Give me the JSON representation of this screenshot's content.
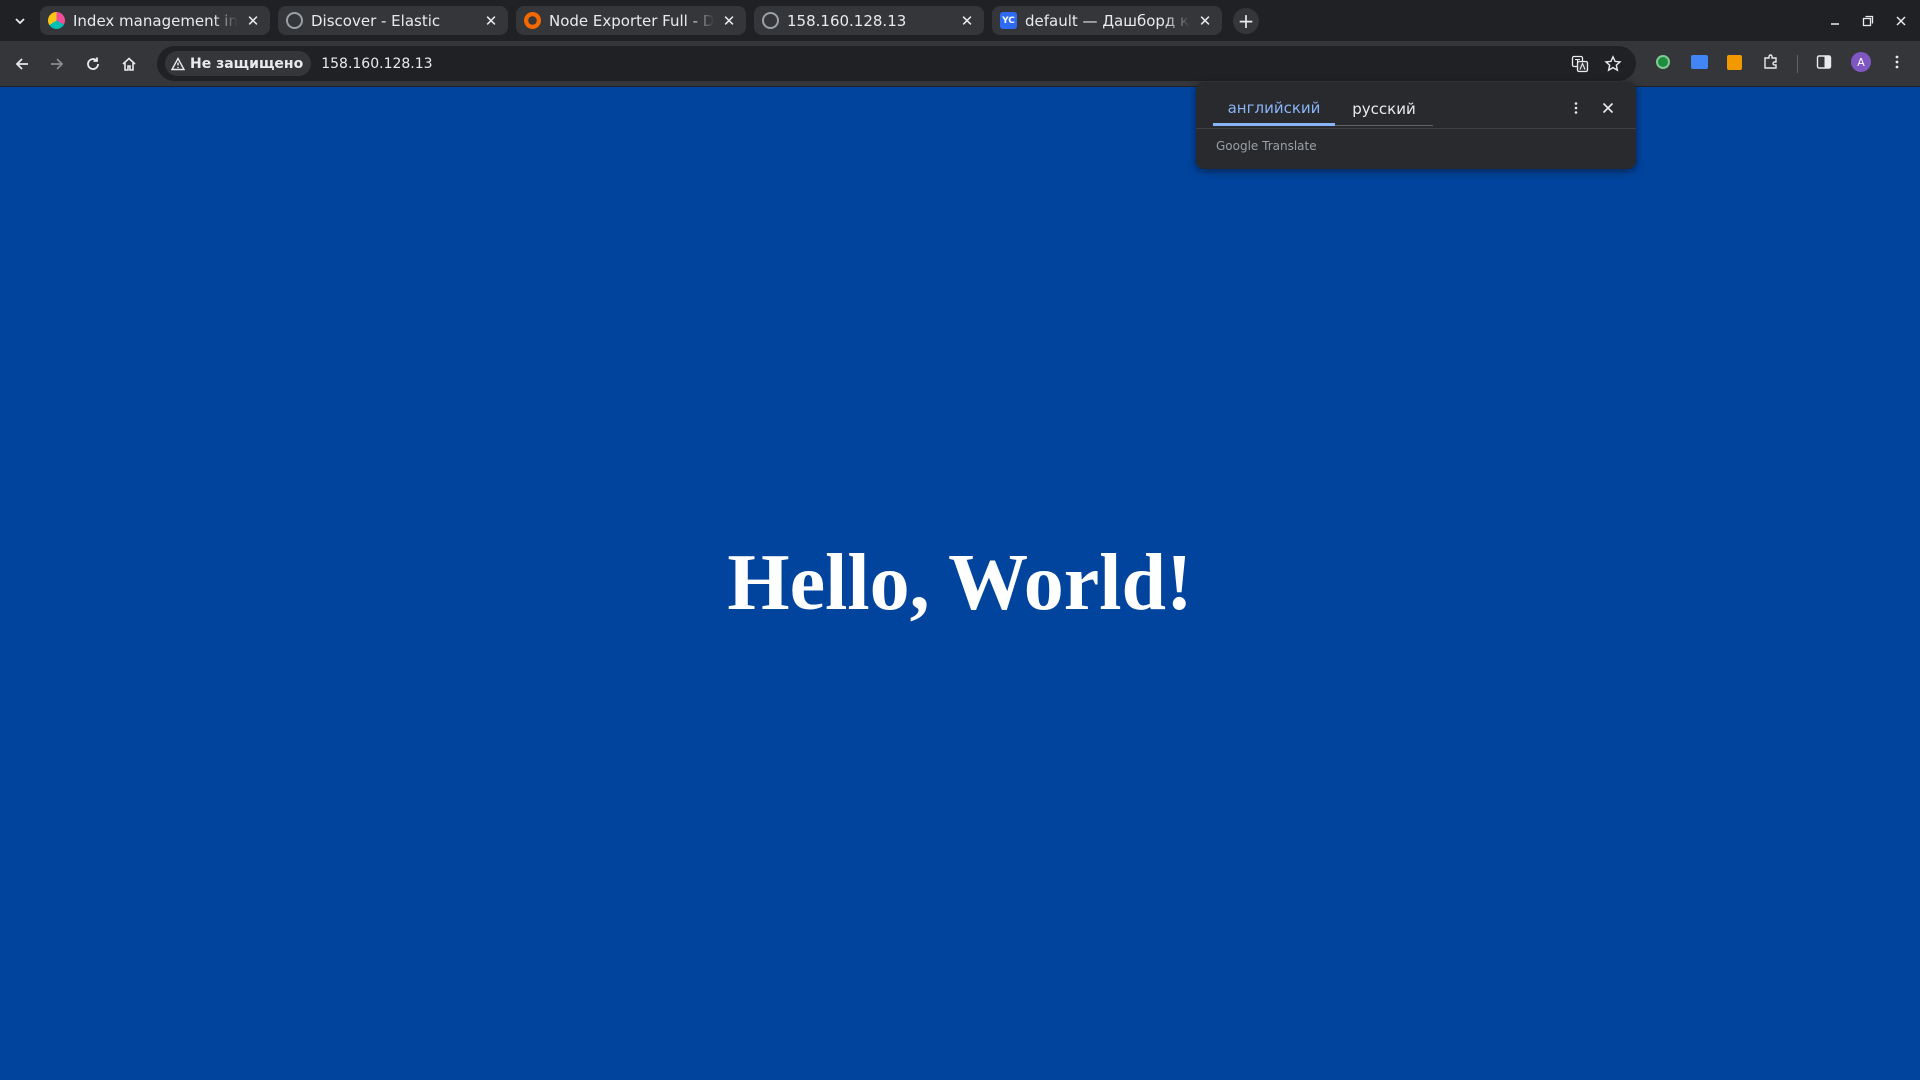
{
  "browser": {
    "tabs": [
      {
        "title": "Index management in Ki",
        "favicon": "kibana-icon",
        "favicon_color": "#f04e98"
      },
      {
        "title": "Discover - Elastic",
        "favicon": "elastic-icon",
        "favicon_color": "#9aa0a6"
      },
      {
        "title": "Node Exporter Full - Das",
        "favicon": "grafana-icon",
        "favicon_color": "#f46800"
      },
      {
        "title": "158.160.128.13",
        "favicon": "globe-icon",
        "favicon_color": "#9aa0a6"
      },
      {
        "title": "default — Дашборд кат",
        "favicon": "yc-icon",
        "favicon_color": "#2f6bf2",
        "favicon_text": "YC"
      }
    ],
    "security_label": "Не защищено",
    "url": "158.160.128.13",
    "profile_initial": "A"
  },
  "translate_popup": {
    "source_lang": "английский",
    "target_lang": "русский",
    "brand": "Google Translate"
  },
  "page": {
    "heading": "Hello, World!",
    "background_color": "#00449e"
  }
}
